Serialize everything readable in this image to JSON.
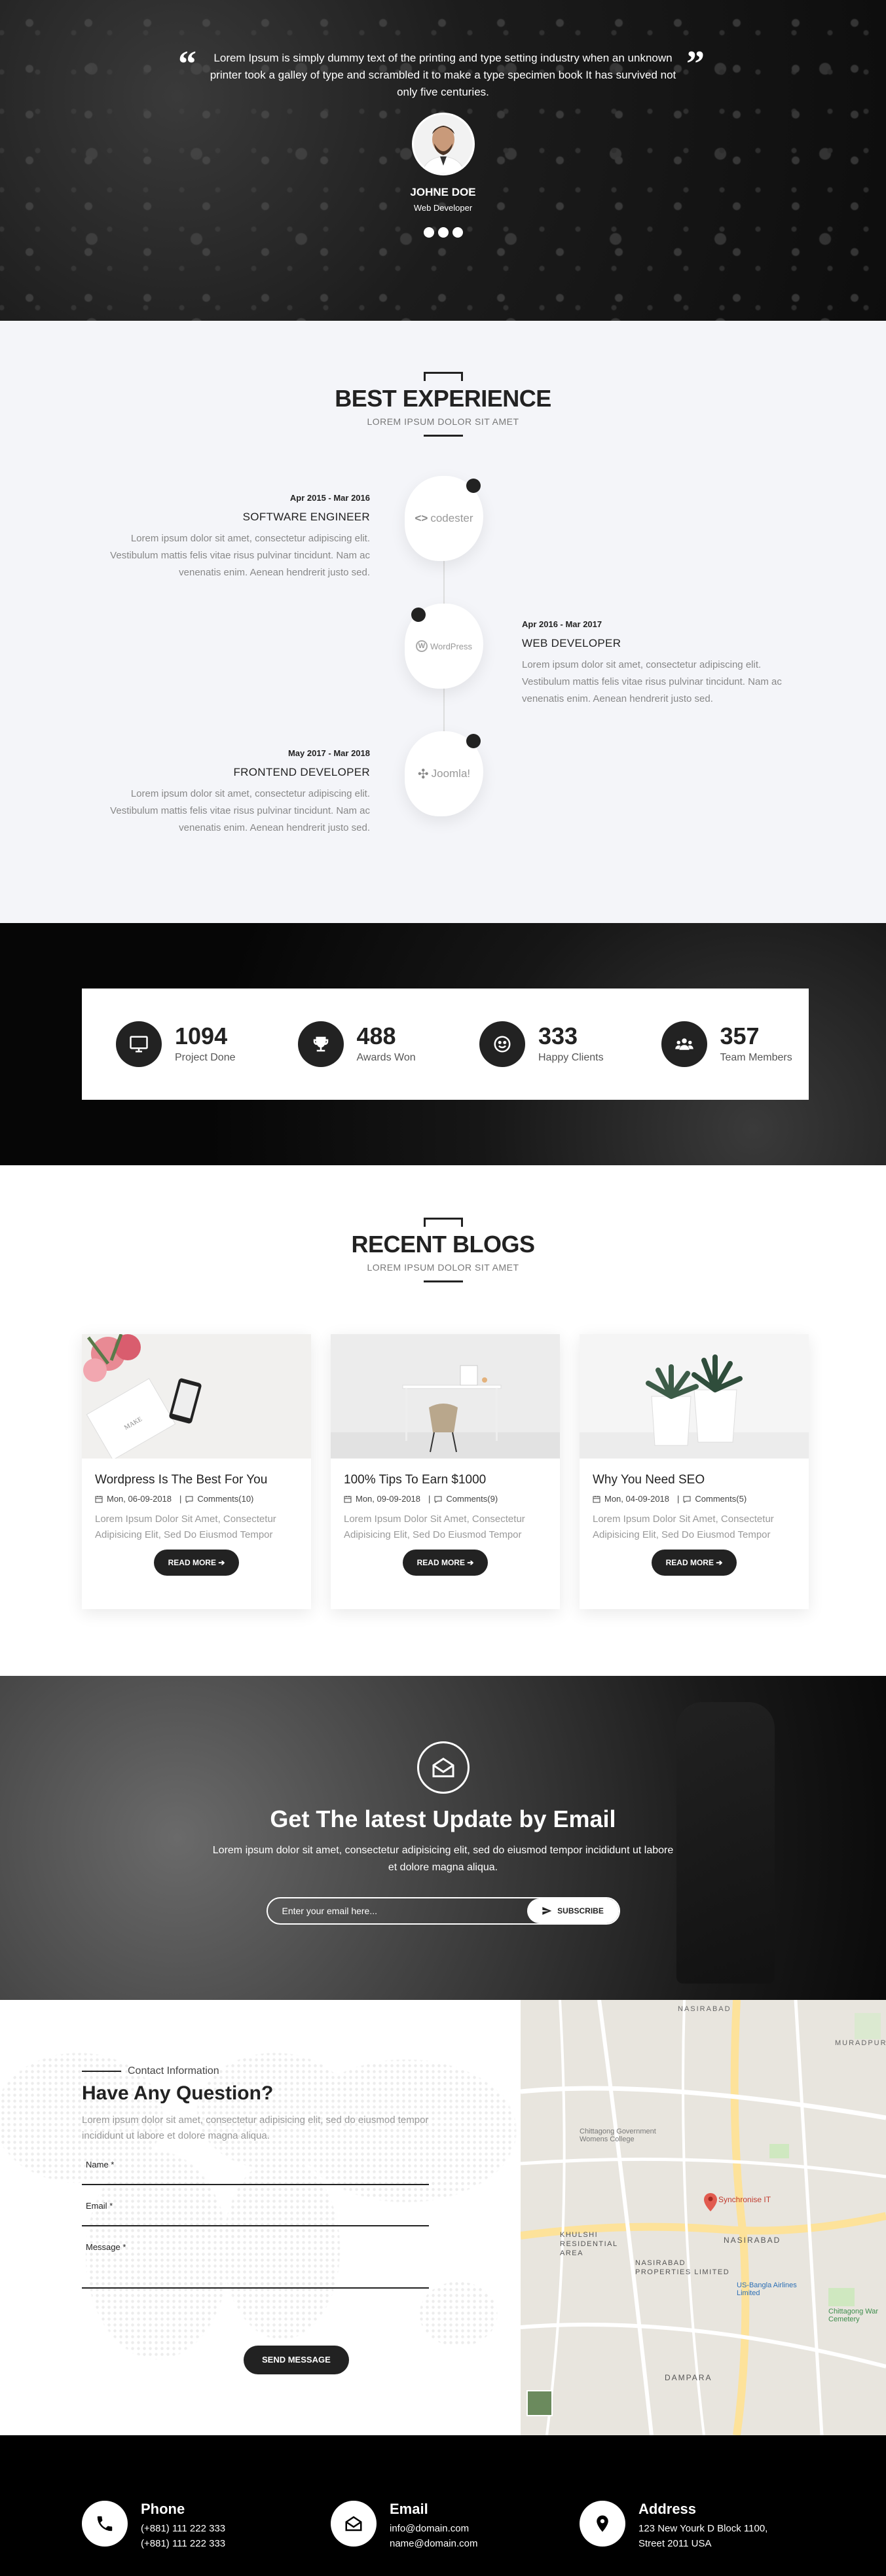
{
  "testimonial": {
    "quote": "Lorem Ipsum is simply dummy text of the printing and type setting industry when an unknown printer took a galley of type and scrambled it to make a type specimen book It has survived not only five centuries.",
    "name": "JOHNE DOE",
    "role": "Web Developer",
    "slides": 3
  },
  "experience": {
    "title": "BEST EXPERIENCE",
    "subtitle": "LOREM IPSUM DOLOR SIT AMET",
    "items": [
      {
        "date": "Apr 2015 - Mar 2016",
        "title": "SOFTWARE ENGINEER",
        "logo": "codester",
        "description": "Lorem ipsum dolor sit amet, consectetur adipiscing elit. Vestibulum mattis felis vitae risus pulvinar tincidunt. Nam ac venenatis enim. Aenean hendrerit justo sed."
      },
      {
        "date": "Apr 2016 - Mar 2017",
        "title": "WEB DEVELOPER",
        "logo": "WordPress",
        "description": "Lorem ipsum dolor sit amet, consectetur adipiscing elit. Vestibulum mattis felis vitae risus pulvinar tincidunt. Nam ac venenatis enim. Aenean hendrerit justo sed."
      },
      {
        "date": "May 2017 - Mar 2018",
        "title": "FRONTEND DEVELOPER",
        "logo": "Joomla!",
        "description": "Lorem ipsum dolor sit amet, consectetur adipiscing elit. Vestibulum mattis felis vitae risus pulvinar tincidunt. Nam ac venenatis enim. Aenean hendrerit justo sed."
      }
    ]
  },
  "counters": [
    {
      "value": "1094",
      "label": "Project Done",
      "icon": "monitor-icon"
    },
    {
      "value": "488",
      "label": "Awards Won",
      "icon": "trophy-icon"
    },
    {
      "value": "333",
      "label": "Happy Clients",
      "icon": "smile-icon"
    },
    {
      "value": "357",
      "label": "Team Members",
      "icon": "team-icon"
    }
  ],
  "blogs": {
    "title": "RECENT BLOGS",
    "subtitle": "LOREM IPSUM DOLOR SIT AMET",
    "posts": [
      {
        "title": "Wordpress Is The Best For You",
        "date": "Mon, 06-09-2018",
        "comments": "Comments(10)",
        "excerpt": "Lorem Ipsum Dolor Sit Amet, Consectetur Adipisicing Elit, Sed Do Eiusmod Tempor",
        "button": "READ MORE"
      },
      {
        "title": "100% Tips To Earn $1000",
        "date": "Mon, 09-09-2018",
        "comments": "Comments(9)",
        "excerpt": "Lorem Ipsum Dolor Sit Amet, Consectetur Adipisicing Elit, Sed Do Eiusmod Tempor",
        "button": "READ MORE"
      },
      {
        "title": "Why You Need SEO",
        "date": "Mon, 04-09-2018",
        "comments": "Comments(5)",
        "excerpt": "Lorem Ipsum Dolor Sit Amet, Consectetur Adipisicing Elit, Sed Do Eiusmod Tempor",
        "button": "READ MORE"
      }
    ]
  },
  "newsletter": {
    "title": "Get The latest Update by Email",
    "description": "Lorem ipsum dolor sit amet, consectetur adipisicing elit, sed do eiusmod tempor incididunt ut labore et dolore magna aliqua.",
    "placeholder": "Enter your email here...",
    "button": "SUBSCRIBE"
  },
  "contact": {
    "label": "Contact Information",
    "title": "Have Any Question?",
    "description": "Lorem ipsum dolor sit amet, consectetur adipisicing elit, sed do eiusmod tempor incididunt ut labore et dolore magna aliqua.",
    "fields": {
      "name": "Name *",
      "email": "Email *",
      "message": "Message *"
    },
    "button": "SEND MESSAGE"
  },
  "map": {
    "labels": [
      "NASIRABAD",
      "MURADPUR",
      "KHULSHI RESIDENTIAL AREA",
      "NASIRABAD PROPERTIES LIMITED",
      "DAMPARA",
      "Synchronise IT",
      "US-Bangla Airlines Limited",
      "Chittagong War Cemetery",
      "Chittagong Government Womens College"
    ]
  },
  "footer": [
    {
      "title": "Phone",
      "lines": [
        "(+881) 111 222 333",
        "(+881) 111 222 333"
      ],
      "icon": "phone-icon"
    },
    {
      "title": "Email",
      "lines": [
        "info@domain.com",
        "name@domain.com"
      ],
      "icon": "envelope-open-icon"
    },
    {
      "title": "Address",
      "lines": [
        "123 New Yourk D Block 1100,",
        "Street 2011 USA"
      ],
      "icon": "map-pin-icon"
    }
  ]
}
